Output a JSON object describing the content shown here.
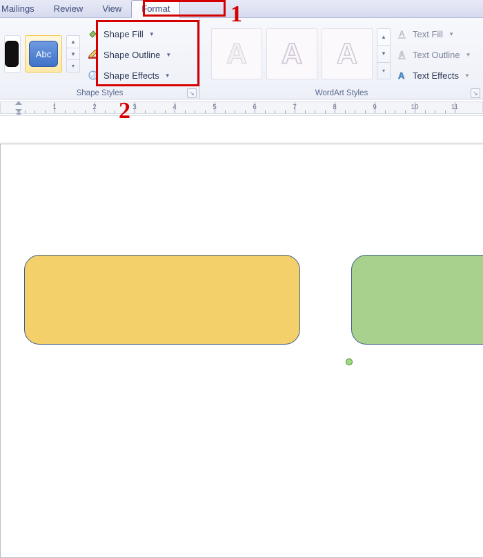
{
  "tabs": {
    "mailings": "Mailings",
    "review": "Review",
    "view": "View",
    "format": "Format"
  },
  "shape_styles": {
    "group_label": "Shape Styles",
    "swatch_text": "Abc",
    "fill_label": "Shape Fill",
    "outline_label": "Shape Outline",
    "effects_label": "Shape Effects"
  },
  "wordart_styles": {
    "group_label": "WordArt Styles",
    "glyph": "A",
    "text_fill_label": "Text Fill",
    "text_outline_label": "Text Outline",
    "text_effects_label": "Text Effects"
  },
  "ruler": {
    "ticks": [
      "1",
      "2",
      "3",
      "4",
      "5",
      "6",
      "7",
      "8",
      "9",
      "10",
      "11"
    ]
  },
  "annotations": {
    "n1": "1",
    "n2": "2"
  },
  "shapes": {
    "s1_color": "#f3d069",
    "s2_color": "#a9d18e",
    "outline": "#3e5f8a"
  }
}
